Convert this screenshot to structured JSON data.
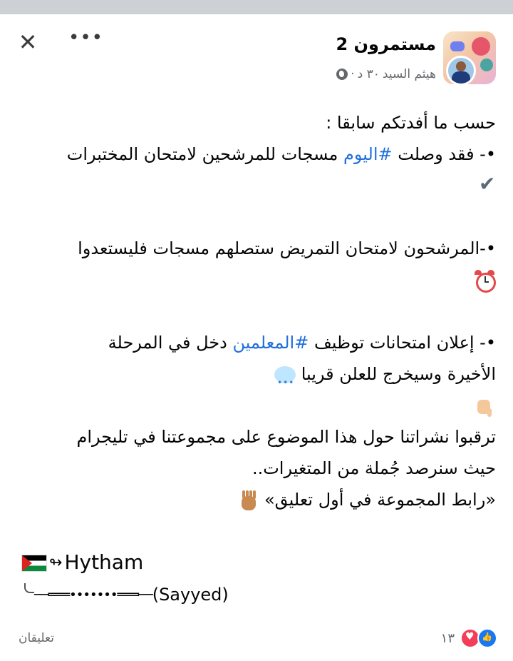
{
  "header": {
    "close_icon": "close-icon",
    "more_icon": "more-options-icon",
    "page_name": "مستمرون 2",
    "author": "هيثم السيد",
    "time": "٣٠ د",
    "separator": "·",
    "privacy_icon": "globe-icon"
  },
  "post": {
    "lines": [
      "حسب ما أفدتكم سابقا :",
      "•- فقد وصلت ",
      "#اليوم",
      " مسجات للمرشحين لامتحان المختبرات",
      "•-المرشحون لامتحان التمريض ستصلهم مسجات فليستعدوا",
      "•-  إعلان امتحانات توظيف ",
      "#المعلمين",
      " دخل في المرحلة",
      "الأخيرة وسيخرج للعلن قريبا",
      "ترقبوا نشراتنا حول هذا الموضوع على مجموعتنا في تليجرام",
      "حيث سنرصد جُملة من المتغيرات..",
      "«رابط المجموعة في أول تعليق»"
    ],
    "emojis": [
      "check-mark-icon",
      "alarm-clock-icon",
      "speech-bubble-icon",
      "pointing-hand-icon",
      "raised-hand-icon"
    ]
  },
  "signature": {
    "flag_icon": "palestine-flag-icon",
    "arrow": "↬",
    "name": "Hytham",
    "line2_dashes": "──═══•••••••═══──",
    "line2_name": "(Sayyed)"
  },
  "footer": {
    "reaction_count": "١٣",
    "reactions": [
      "like-icon",
      "love-icon"
    ],
    "comments_label": "تعليقان"
  },
  "colors": {
    "hashtag": "#216fdb",
    "secondary_text": "#65676b",
    "like": "#1877f2",
    "love": "#f33e58"
  }
}
